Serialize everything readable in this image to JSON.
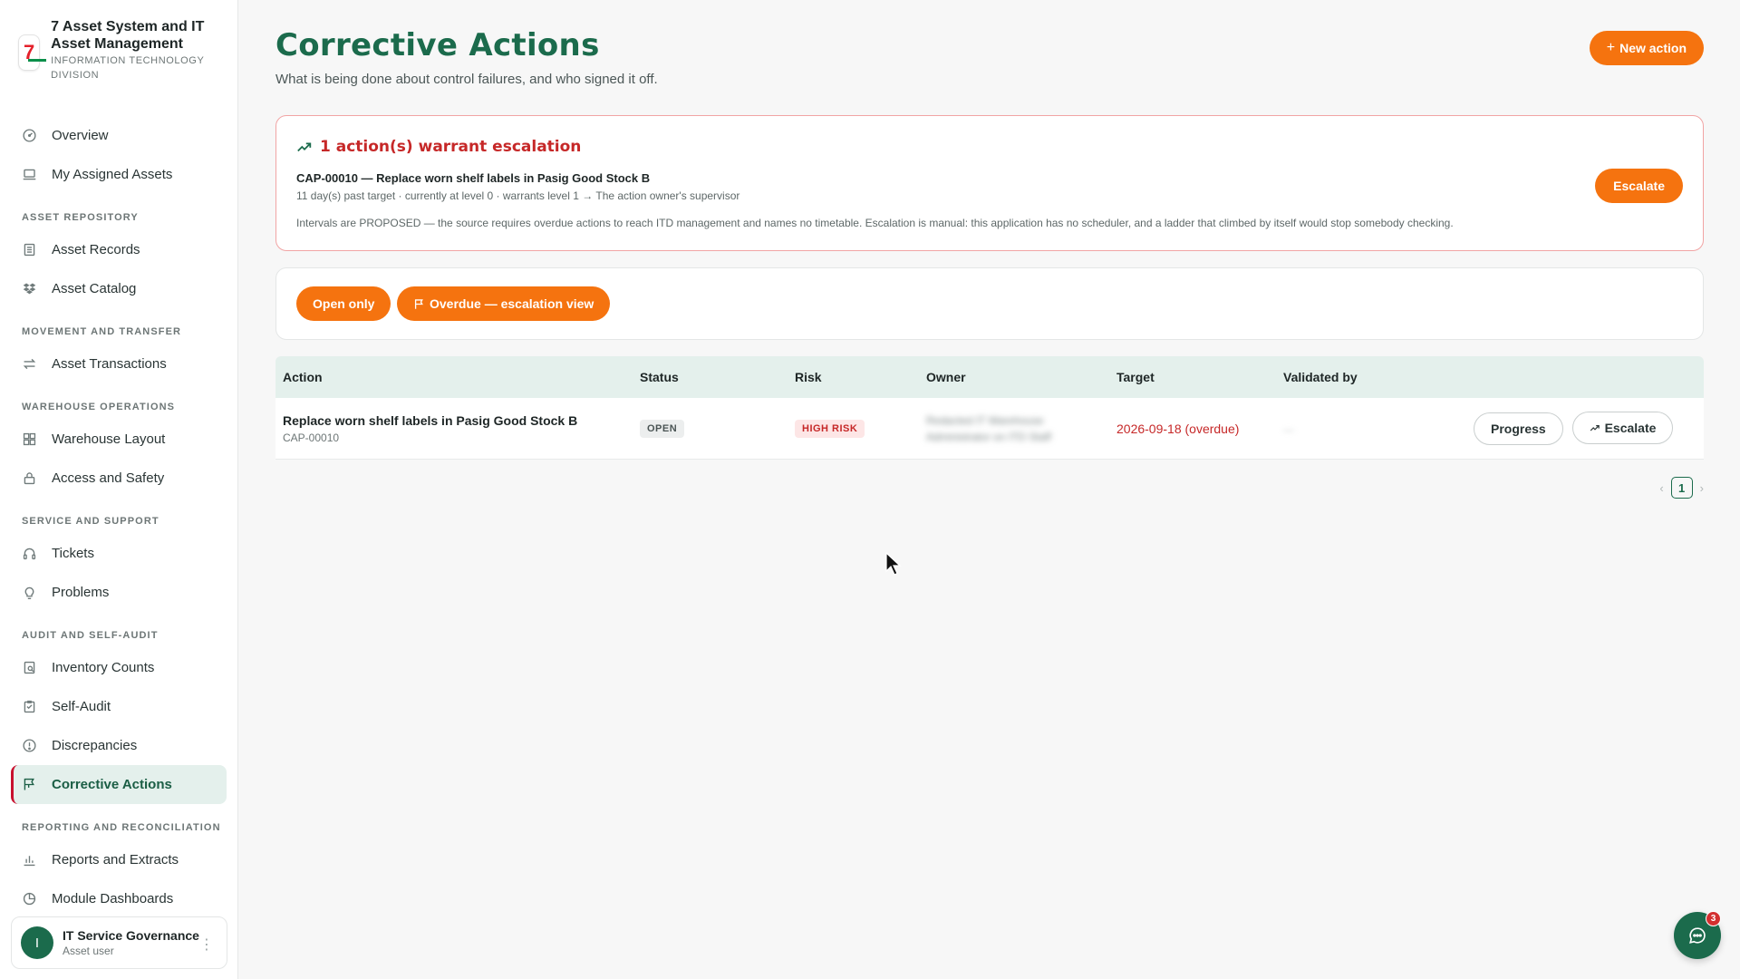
{
  "brand": {
    "title": "7 Asset System and IT Asset Management",
    "subtitle": "INFORMATION TECHNOLOGY DIVISION",
    "logo_text": "7"
  },
  "sidebar": {
    "top_items": [
      {
        "label": "Overview",
        "icon": "gauge-icon"
      },
      {
        "label": "My Assigned Assets",
        "icon": "laptop-icon"
      }
    ],
    "sections": [
      {
        "title": "ASSET REPOSITORY",
        "items": [
          {
            "label": "Asset Records",
            "icon": "records-icon"
          },
          {
            "label": "Asset Catalog",
            "icon": "dropbox-icon"
          }
        ]
      },
      {
        "title": "MOVEMENT AND TRANSFER",
        "items": [
          {
            "label": "Asset Transactions",
            "icon": "transfer-icon"
          }
        ]
      },
      {
        "title": "WAREHOUSE OPERATIONS",
        "items": [
          {
            "label": "Warehouse Layout",
            "icon": "grid-icon"
          },
          {
            "label": "Access and Safety",
            "icon": "lock-icon"
          }
        ]
      },
      {
        "title": "SERVICE AND SUPPORT",
        "items": [
          {
            "label": "Tickets",
            "icon": "headset-icon"
          },
          {
            "label": "Problems",
            "icon": "bulb-icon"
          }
        ]
      },
      {
        "title": "AUDIT AND SELF-AUDIT",
        "items": [
          {
            "label": "Inventory Counts",
            "icon": "count-icon"
          },
          {
            "label": "Self-Audit",
            "icon": "clipboard-icon"
          },
          {
            "label": "Discrepancies",
            "icon": "alert-circle-icon"
          },
          {
            "label": "Corrective Actions",
            "icon": "flag-icon",
            "active": true
          }
        ]
      },
      {
        "title": "REPORTING AND RECONCILIATION",
        "items": [
          {
            "label": "Reports and Extracts",
            "icon": "bar-chart-icon"
          },
          {
            "label": "Module Dashboards",
            "icon": "pie-chart-icon"
          }
        ]
      }
    ]
  },
  "user": {
    "initial": "I",
    "name": "IT Service Governance",
    "role": "Asset user"
  },
  "header": {
    "title": "Corrective Actions",
    "subtitle": "What is being done about control failures, and who signed it off.",
    "new_button": "New action",
    "new_button_plus": "+"
  },
  "alert": {
    "title": "1 action(s) warrant escalation",
    "item": "CAP-00010 — Replace worn shelf labels in Pasig Good Stock B",
    "meta": "11 day(s) past target · currently at level 0 · warrants level 1 → The action owner's supervisor",
    "note": "Intervals are PROPOSED — the source requires overdue actions to reach ITD management and names no timetable. Escalation is manual: this application has no scheduler, and a ladder that climbed by itself would stop somebody checking.",
    "button": "Escalate"
  },
  "filters": {
    "open_only": "Open only",
    "overdue_view": "Overdue — escalation view"
  },
  "table": {
    "headers": [
      "Action",
      "Status",
      "Risk",
      "Owner",
      "Target",
      "Validated by"
    ],
    "rows": [
      {
        "title": "Replace worn shelf labels in Pasig Good Stock B",
        "id": "CAP-00010",
        "status": "OPEN",
        "risk": "HIGH RISK",
        "owner_line1": "Redacted IT Warehouse",
        "owner_line2": "Administrator on ITD Staff",
        "target": "2026-09-18 (overdue)",
        "validated_by": "—",
        "progress_button": "Progress",
        "escalate_button": "Escalate"
      }
    ]
  },
  "pagination": {
    "prev": "‹",
    "current": "1",
    "next": "›"
  },
  "chat": {
    "badge_count": "3"
  },
  "colors": {
    "brand_green": "#1b6b4c",
    "accent_orange": "#f5730f",
    "danger_red": "#c62828",
    "active_bg": "#e4f0ec"
  }
}
